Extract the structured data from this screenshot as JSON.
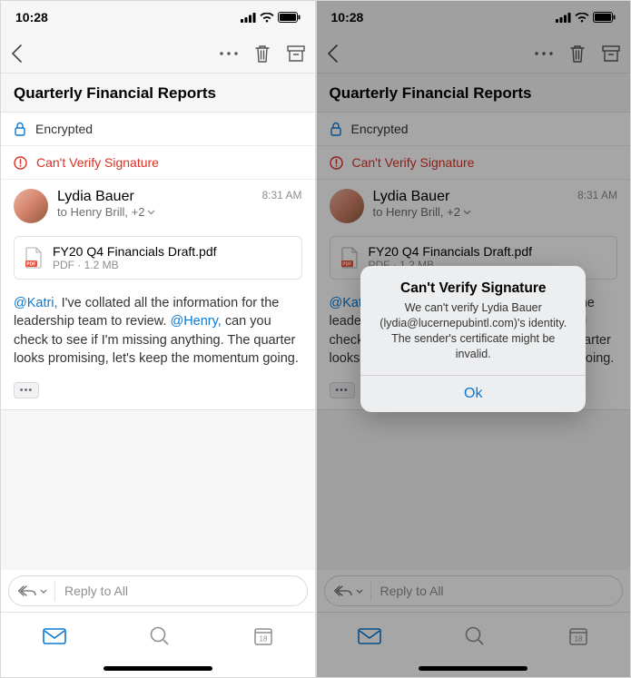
{
  "status": {
    "time": "10:28"
  },
  "subject": "Quarterly Financial Reports",
  "encrypted_label": "Encrypted",
  "signature_error": "Can't Verify Signature",
  "sender": {
    "name": "Lydia Bauer",
    "to_line": "to Henry Brill, +2",
    "time": "8:31 AM"
  },
  "attachment": {
    "name": "FY20 Q4 Financials Draft.pdf",
    "meta": "PDF · 1.2 MB"
  },
  "mention1": "@Katri,",
  "body_part1": " I've collated all the information for the leadership team to review. ",
  "mention2": "@Henry,",
  "body_part2": " can you check to see if I'm missing anything. The quarter looks promising, let's keep the momentum going.",
  "reply_placeholder": "Reply to All",
  "calendar_day": "18",
  "alert": {
    "title": "Can't Verify Signature",
    "message": "We can't verify Lydia Bauer (lydia@lucernepubintl.com)'s identity. The sender's certificate might be invalid.",
    "ok": "Ok"
  }
}
